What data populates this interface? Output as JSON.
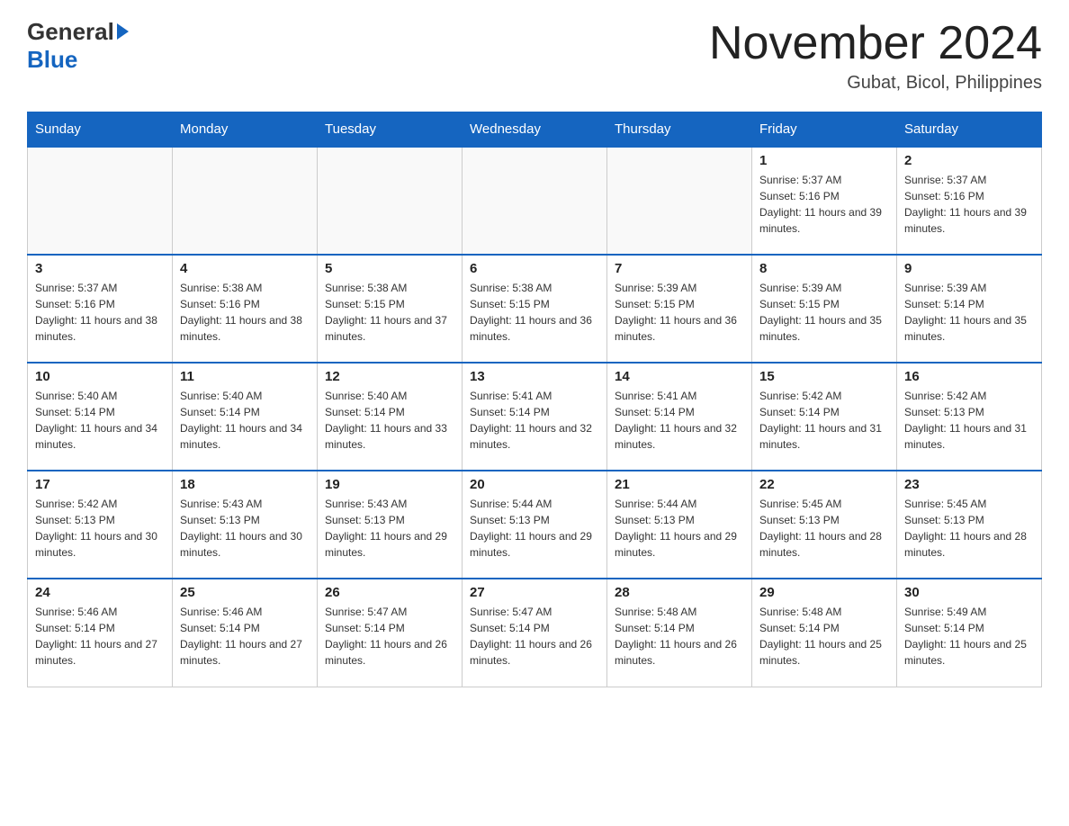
{
  "header": {
    "logo_general": "General",
    "logo_blue": "Blue",
    "month_year": "November 2024",
    "location": "Gubat, Bicol, Philippines"
  },
  "weekdays": [
    "Sunday",
    "Monday",
    "Tuesday",
    "Wednesday",
    "Thursday",
    "Friday",
    "Saturday"
  ],
  "weeks": [
    [
      {
        "day": "",
        "sunrise": "",
        "sunset": "",
        "daylight": ""
      },
      {
        "day": "",
        "sunrise": "",
        "sunset": "",
        "daylight": ""
      },
      {
        "day": "",
        "sunrise": "",
        "sunset": "",
        "daylight": ""
      },
      {
        "day": "",
        "sunrise": "",
        "sunset": "",
        "daylight": ""
      },
      {
        "day": "",
        "sunrise": "",
        "sunset": "",
        "daylight": ""
      },
      {
        "day": "1",
        "sunrise": "Sunrise: 5:37 AM",
        "sunset": "Sunset: 5:16 PM",
        "daylight": "Daylight: 11 hours and 39 minutes."
      },
      {
        "day": "2",
        "sunrise": "Sunrise: 5:37 AM",
        "sunset": "Sunset: 5:16 PM",
        "daylight": "Daylight: 11 hours and 39 minutes."
      }
    ],
    [
      {
        "day": "3",
        "sunrise": "Sunrise: 5:37 AM",
        "sunset": "Sunset: 5:16 PM",
        "daylight": "Daylight: 11 hours and 38 minutes."
      },
      {
        "day": "4",
        "sunrise": "Sunrise: 5:38 AM",
        "sunset": "Sunset: 5:16 PM",
        "daylight": "Daylight: 11 hours and 38 minutes."
      },
      {
        "day": "5",
        "sunrise": "Sunrise: 5:38 AM",
        "sunset": "Sunset: 5:15 PM",
        "daylight": "Daylight: 11 hours and 37 minutes."
      },
      {
        "day": "6",
        "sunrise": "Sunrise: 5:38 AM",
        "sunset": "Sunset: 5:15 PM",
        "daylight": "Daylight: 11 hours and 36 minutes."
      },
      {
        "day": "7",
        "sunrise": "Sunrise: 5:39 AM",
        "sunset": "Sunset: 5:15 PM",
        "daylight": "Daylight: 11 hours and 36 minutes."
      },
      {
        "day": "8",
        "sunrise": "Sunrise: 5:39 AM",
        "sunset": "Sunset: 5:15 PM",
        "daylight": "Daylight: 11 hours and 35 minutes."
      },
      {
        "day": "9",
        "sunrise": "Sunrise: 5:39 AM",
        "sunset": "Sunset: 5:14 PM",
        "daylight": "Daylight: 11 hours and 35 minutes."
      }
    ],
    [
      {
        "day": "10",
        "sunrise": "Sunrise: 5:40 AM",
        "sunset": "Sunset: 5:14 PM",
        "daylight": "Daylight: 11 hours and 34 minutes."
      },
      {
        "day": "11",
        "sunrise": "Sunrise: 5:40 AM",
        "sunset": "Sunset: 5:14 PM",
        "daylight": "Daylight: 11 hours and 34 minutes."
      },
      {
        "day": "12",
        "sunrise": "Sunrise: 5:40 AM",
        "sunset": "Sunset: 5:14 PM",
        "daylight": "Daylight: 11 hours and 33 minutes."
      },
      {
        "day": "13",
        "sunrise": "Sunrise: 5:41 AM",
        "sunset": "Sunset: 5:14 PM",
        "daylight": "Daylight: 11 hours and 32 minutes."
      },
      {
        "day": "14",
        "sunrise": "Sunrise: 5:41 AM",
        "sunset": "Sunset: 5:14 PM",
        "daylight": "Daylight: 11 hours and 32 minutes."
      },
      {
        "day": "15",
        "sunrise": "Sunrise: 5:42 AM",
        "sunset": "Sunset: 5:14 PM",
        "daylight": "Daylight: 11 hours and 31 minutes."
      },
      {
        "day": "16",
        "sunrise": "Sunrise: 5:42 AM",
        "sunset": "Sunset: 5:13 PM",
        "daylight": "Daylight: 11 hours and 31 minutes."
      }
    ],
    [
      {
        "day": "17",
        "sunrise": "Sunrise: 5:42 AM",
        "sunset": "Sunset: 5:13 PM",
        "daylight": "Daylight: 11 hours and 30 minutes."
      },
      {
        "day": "18",
        "sunrise": "Sunrise: 5:43 AM",
        "sunset": "Sunset: 5:13 PM",
        "daylight": "Daylight: 11 hours and 30 minutes."
      },
      {
        "day": "19",
        "sunrise": "Sunrise: 5:43 AM",
        "sunset": "Sunset: 5:13 PM",
        "daylight": "Daylight: 11 hours and 29 minutes."
      },
      {
        "day": "20",
        "sunrise": "Sunrise: 5:44 AM",
        "sunset": "Sunset: 5:13 PM",
        "daylight": "Daylight: 11 hours and 29 minutes."
      },
      {
        "day": "21",
        "sunrise": "Sunrise: 5:44 AM",
        "sunset": "Sunset: 5:13 PM",
        "daylight": "Daylight: 11 hours and 29 minutes."
      },
      {
        "day": "22",
        "sunrise": "Sunrise: 5:45 AM",
        "sunset": "Sunset: 5:13 PM",
        "daylight": "Daylight: 11 hours and 28 minutes."
      },
      {
        "day": "23",
        "sunrise": "Sunrise: 5:45 AM",
        "sunset": "Sunset: 5:13 PM",
        "daylight": "Daylight: 11 hours and 28 minutes."
      }
    ],
    [
      {
        "day": "24",
        "sunrise": "Sunrise: 5:46 AM",
        "sunset": "Sunset: 5:14 PM",
        "daylight": "Daylight: 11 hours and 27 minutes."
      },
      {
        "day": "25",
        "sunrise": "Sunrise: 5:46 AM",
        "sunset": "Sunset: 5:14 PM",
        "daylight": "Daylight: 11 hours and 27 minutes."
      },
      {
        "day": "26",
        "sunrise": "Sunrise: 5:47 AM",
        "sunset": "Sunset: 5:14 PM",
        "daylight": "Daylight: 11 hours and 26 minutes."
      },
      {
        "day": "27",
        "sunrise": "Sunrise: 5:47 AM",
        "sunset": "Sunset: 5:14 PM",
        "daylight": "Daylight: 11 hours and 26 minutes."
      },
      {
        "day": "28",
        "sunrise": "Sunrise: 5:48 AM",
        "sunset": "Sunset: 5:14 PM",
        "daylight": "Daylight: 11 hours and 26 minutes."
      },
      {
        "day": "29",
        "sunrise": "Sunrise: 5:48 AM",
        "sunset": "Sunset: 5:14 PM",
        "daylight": "Daylight: 11 hours and 25 minutes."
      },
      {
        "day": "30",
        "sunrise": "Sunrise: 5:49 AM",
        "sunset": "Sunset: 5:14 PM",
        "daylight": "Daylight: 11 hours and 25 minutes."
      }
    ]
  ]
}
